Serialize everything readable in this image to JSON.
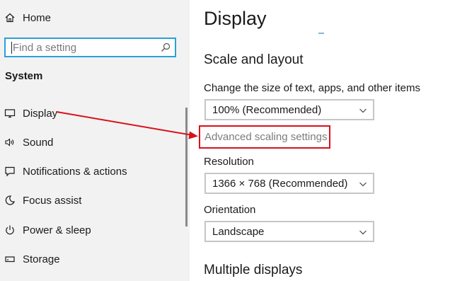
{
  "sidebar": {
    "home_label": "Home",
    "search": {
      "placeholder": "Find a setting"
    },
    "section_title": "System",
    "items": [
      {
        "label": "Display",
        "icon": "monitor-icon"
      },
      {
        "label": "Sound",
        "icon": "speaker-icon"
      },
      {
        "label": "Notifications & actions",
        "icon": "notification-icon"
      },
      {
        "label": "Focus assist",
        "icon": "moon-icon"
      },
      {
        "label": "Power & sleep",
        "icon": "power-icon"
      },
      {
        "label": "Storage",
        "icon": "storage-icon"
      }
    ]
  },
  "main": {
    "title": "Display",
    "scale_section": {
      "heading": "Scale and layout",
      "size_label": "Change the size of text, apps, and other items",
      "size_value": "100% (Recommended)",
      "advanced_link": "Advanced scaling settings",
      "resolution_label": "Resolution",
      "resolution_value": "1366 × 768 (Recommended)",
      "orientation_label": "Orientation",
      "orientation_value": "Landscape"
    },
    "multiple_displays_heading": "Multiple displays"
  },
  "colors": {
    "annotation_red": "#d9101a",
    "search_border": "#2aa0d8",
    "sidebar_bg": "#f2f2f2",
    "link_gray": "#7c7c7c"
  }
}
